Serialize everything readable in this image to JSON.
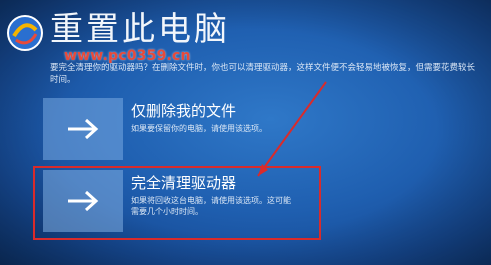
{
  "page": {
    "title": "重置此电脑",
    "description": "要完全清理你的驱动器吗？在删除文件时，你也可以清理驱动器，这样文件便不会轻易地被恢复，但需要花费较长时间。"
  },
  "watermark": {
    "site": "www.pc0359.cn"
  },
  "options": [
    {
      "title": "仅删除我的文件",
      "description": "如果要保留你的电脑，请使用该选项。"
    },
    {
      "title": "完全清理驱动器",
      "description": "如果将回收这台电脑，请使用该选项。这可能需要几个小时时间。"
    }
  ],
  "colors": {
    "background": "#1f5fb0",
    "highlight": "#d92b2b",
    "watermark": "#e84a3a"
  },
  "icons": {
    "option_icon": "arrow-right-icon",
    "logo": "site-logo-icon"
  }
}
